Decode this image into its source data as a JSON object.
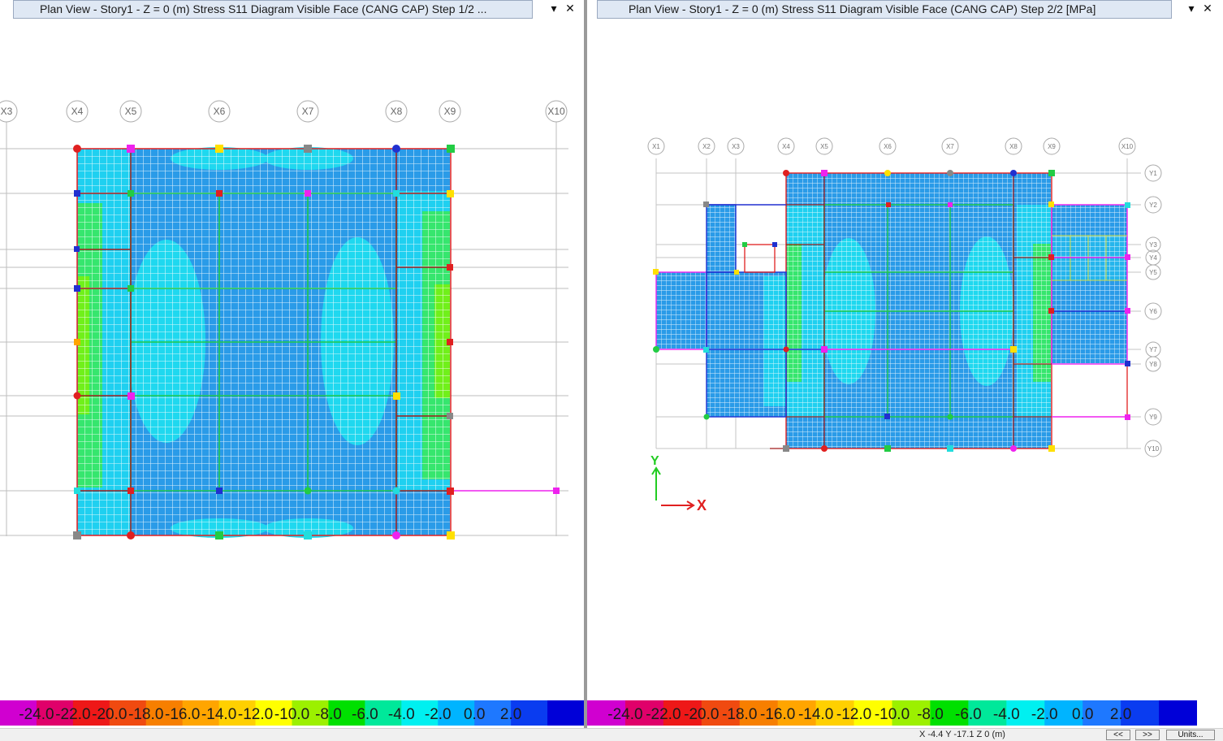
{
  "left_window": {
    "title": "Plan View - Story1 - Z = 0 (m)   Stress S11 Diagram  Visible Face   (CANG CAP)  Step 1/2  ...",
    "dropdown_icon": "chevron-down-icon",
    "close_icon": "close-icon",
    "grid_labels": [
      "X3",
      "X4",
      "X5",
      "X6",
      "X7",
      "X8",
      "X9",
      "X10"
    ]
  },
  "right_window": {
    "title": "Plan View - Story1 - Z = 0 (m)   Stress S11 Diagram  Visible Face   (CANG CAP)  Step 2/2  [MPa]",
    "dropdown_icon": "chevron-down-icon",
    "close_icon": "close-icon",
    "grid_labels_x": [
      "X1",
      "X2",
      "X3",
      "X4",
      "X5",
      "X6",
      "X7",
      "X8",
      "X9",
      "X10"
    ],
    "grid_labels_y": [
      "Y1",
      "Y2",
      "Y3",
      "Y4",
      "Y5",
      "Y6",
      "Y7",
      "Y8",
      "Y9",
      "Y10"
    ],
    "axis_labels": {
      "x": "X",
      "y": "Y"
    }
  },
  "legend": {
    "values": [
      "-24.0",
      "-22.0",
      "-20.0",
      "-18.0",
      "-16.0",
      "-14.0",
      "-12.0",
      "-10.0",
      "-8.0",
      "-6.0",
      "-4.0",
      "-2.0",
      "0.0",
      "2.0"
    ],
    "colors": [
      "#d000d0",
      "#e0006a",
      "#ee1818",
      "#f04a10",
      "#f77f00",
      "#ffa500",
      "#ffd000",
      "#ffff00",
      "#9cf000",
      "#00e000",
      "#00e89a",
      "#00f0f0",
      "#00b4ff",
      "#1e78ff",
      "#0a3cf0",
      "#0000d8"
    ]
  },
  "status_bar": {
    "coordinates": "X -4.4  Y -17.1  Z 0 (m)",
    "prev_button": "<<",
    "next_button": ">>",
    "units_button": "Units..."
  }
}
